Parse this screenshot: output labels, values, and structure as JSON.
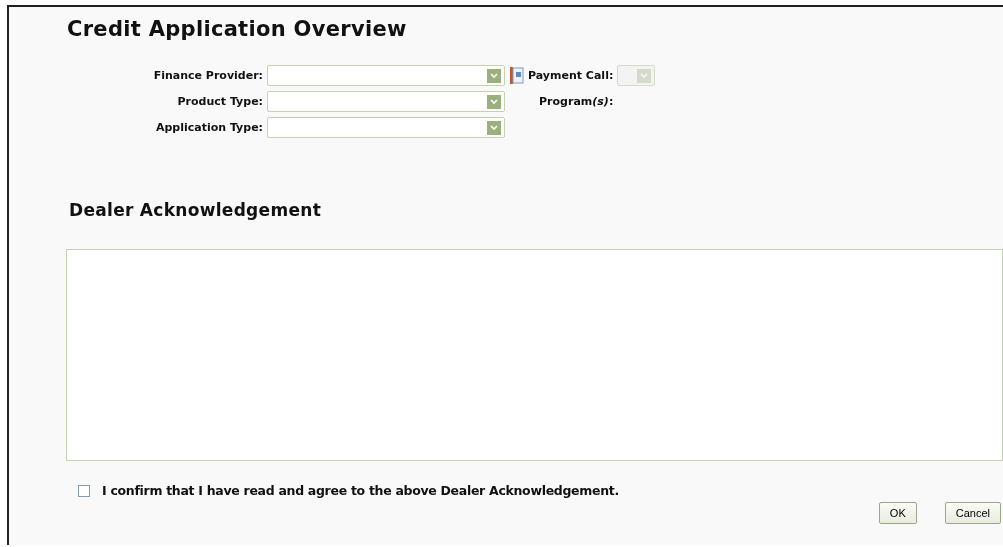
{
  "title": "Credit Application Overview",
  "fields": [
    {
      "label": "Finance Provider:"
    },
    {
      "label": "Product Type:"
    },
    {
      "label": "Application Type:"
    }
  ],
  "payment_call": {
    "label": "Payment Call:",
    "disabled": true
  },
  "programs": {
    "parts": [
      {
        "text": "Program",
        "italic": false
      },
      {
        "text": "(s)",
        "italic": true
      },
      {
        "text": ":",
        "italic": false
      }
    ]
  },
  "acknowledgement": {
    "heading": "Dealer Acknowledgement"
  },
  "confirm": {
    "label": "I confirm that I have read and agree to the above Dealer Acknowledgement.",
    "checked": false
  },
  "buttons": [
    {
      "label": "OK"
    },
    {
      "label": "Cancel"
    }
  ]
}
